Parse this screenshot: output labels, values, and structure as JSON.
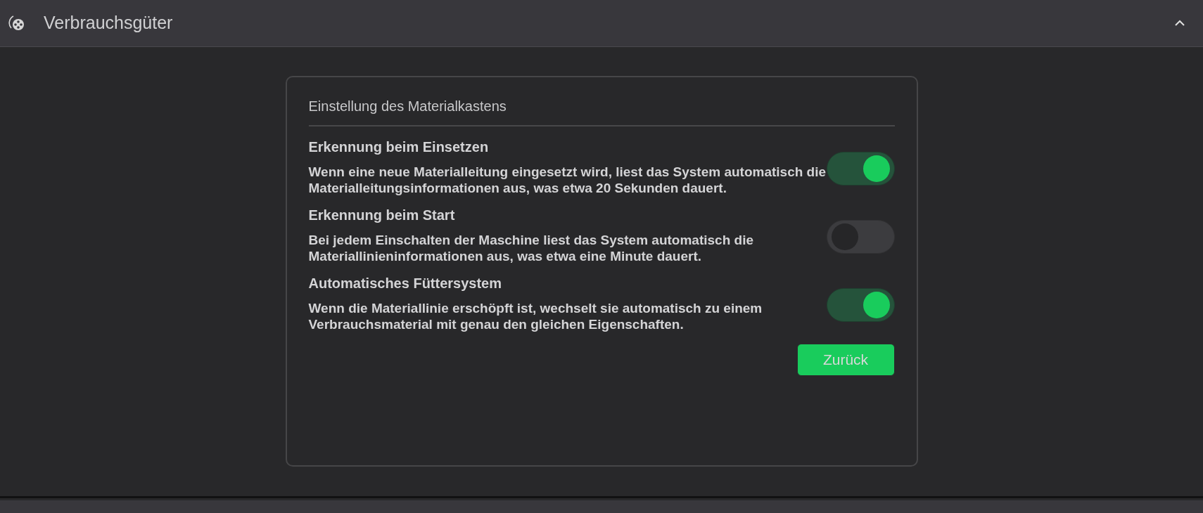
{
  "header": {
    "title": "Verbrauchsgüter",
    "expanded": true
  },
  "panel": {
    "title": "Einstellung des Materialkastens",
    "settings": [
      {
        "label": "Erkennung beim Einsetzen",
        "description": "Wenn eine neue Materialleitung eingesetzt wird, liest das System automatisch die Materialleitungsinformationen aus, was etwa 20 Sekunden dauert.",
        "on": true
      },
      {
        "label": "Erkennung beim Start",
        "description": "Bei jedem Einschalten der Maschine liest das System automatisch die Materiallinieninformationen aus, was etwa eine Minute dauert.",
        "on": false
      },
      {
        "label": "Automatisches Füttersystem",
        "description": "Wenn die Materiallinie erschöpft ist, wechselt sie automatisch zu einem Verbrauchsmaterial mit genau den gleichen Eigenschaften.",
        "on": true
      }
    ],
    "button": "Zurück"
  }
}
